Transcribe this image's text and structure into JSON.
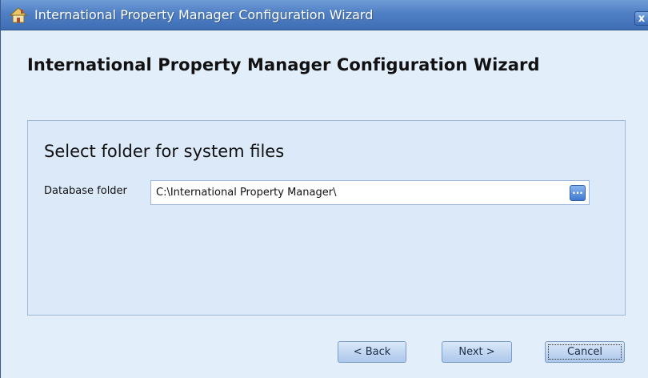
{
  "window": {
    "title": "International Property Manager Configuration Wizard",
    "close_symbol": "x"
  },
  "header": {
    "title": "International Property Manager Configuration Wizard"
  },
  "panel": {
    "title": "Select folder for system files",
    "field_label": "Database folder",
    "field_value": "C:\\International Property Manager\\",
    "browse_symbol": "..."
  },
  "buttons": {
    "back": "< Back",
    "next": "Next >",
    "cancel": "Cancel"
  },
  "icons": {
    "app": "house-icon",
    "close": "close-icon",
    "browse": "ellipsis-icon"
  },
  "colors": {
    "titlebar": "#4f7fc4",
    "background": "#e3eefb",
    "panel": "#dbe9f9"
  }
}
